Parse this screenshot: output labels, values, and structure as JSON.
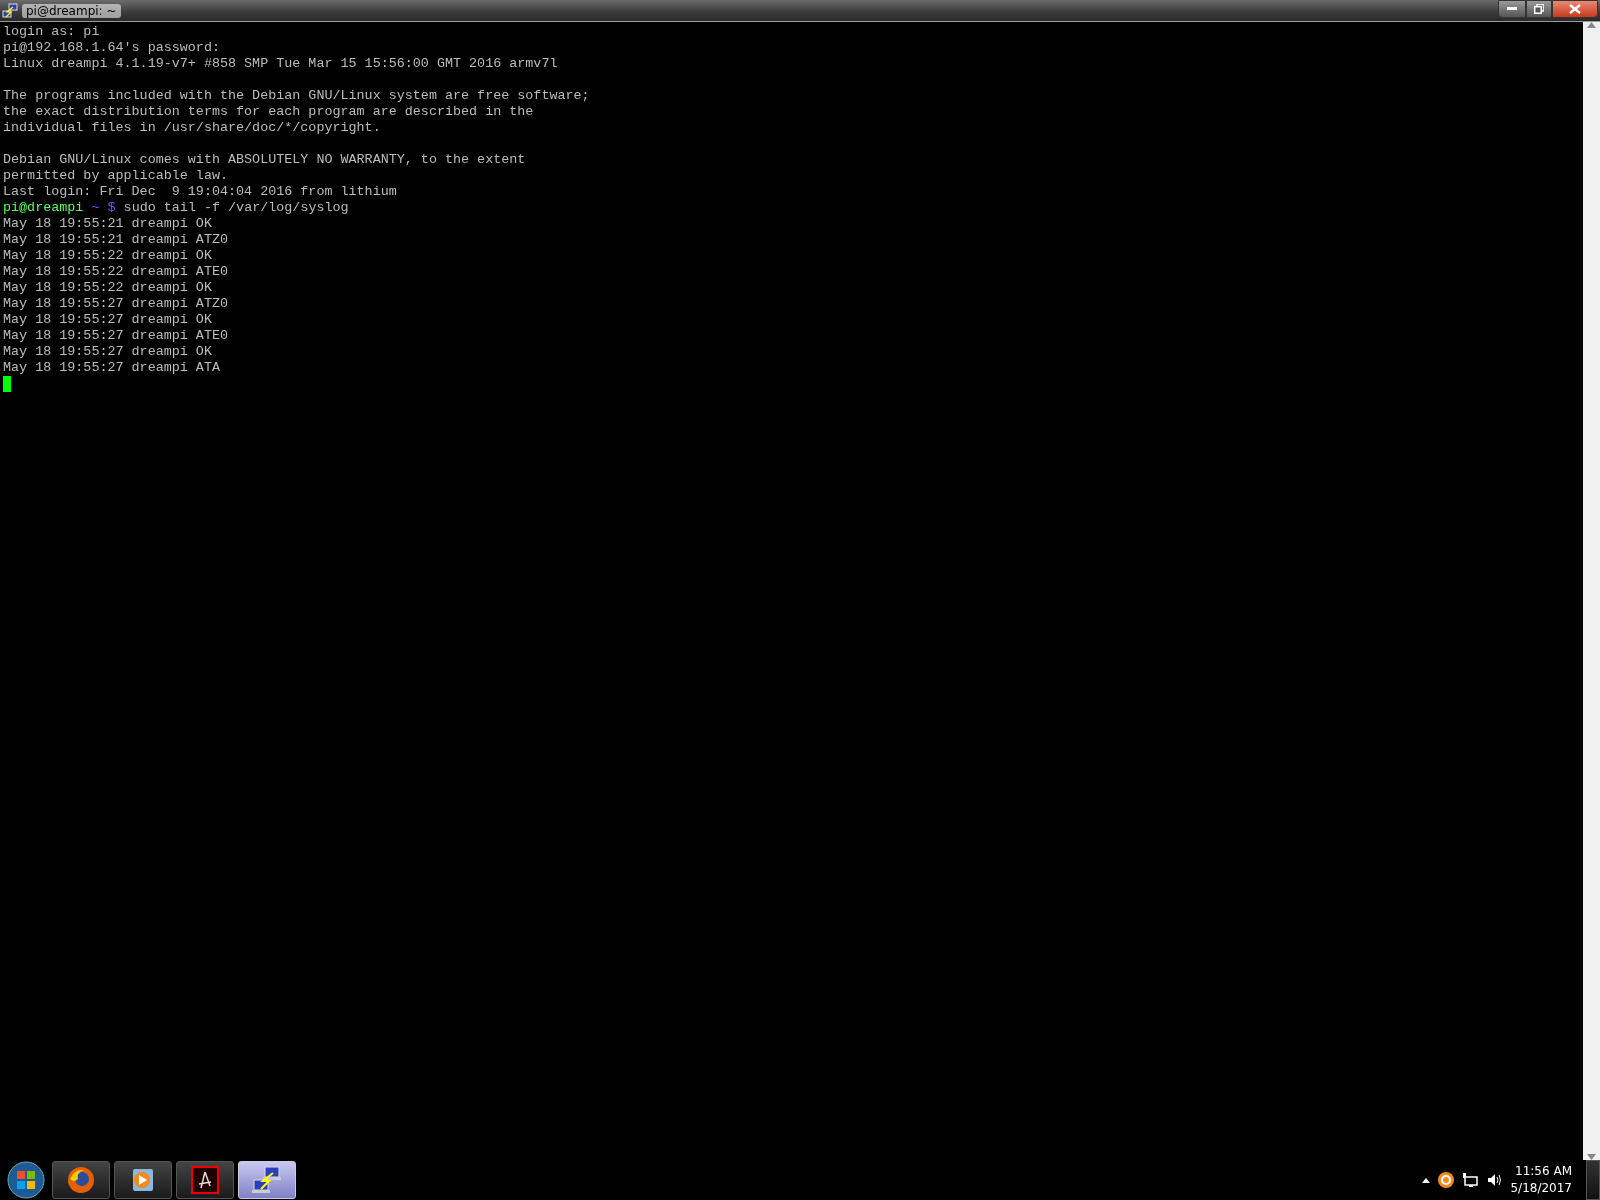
{
  "window": {
    "title": "pi@dreampi: ~"
  },
  "terminal": {
    "lines": [
      {
        "kind": "text",
        "text": "login as: pi"
      },
      {
        "kind": "text",
        "text": "pi@192.168.1.64's password:"
      },
      {
        "kind": "text",
        "text": "Linux dreampi 4.1.19-v7+ #858 SMP Tue Mar 15 15:56:00 GMT 2016 armv7l"
      },
      {
        "kind": "blank"
      },
      {
        "kind": "text",
        "text": "The programs included with the Debian GNU/Linux system are free software;"
      },
      {
        "kind": "text",
        "text": "the exact distribution terms for each program are described in the"
      },
      {
        "kind": "text",
        "text": "individual files in /usr/share/doc/*/copyright."
      },
      {
        "kind": "blank"
      },
      {
        "kind": "text",
        "text": "Debian GNU/Linux comes with ABSOLUTELY NO WARRANTY, to the extent"
      },
      {
        "kind": "text",
        "text": "permitted by applicable law."
      },
      {
        "kind": "text",
        "text": "Last login: Fri Dec  9 19:04:04 2016 from lithium"
      },
      {
        "kind": "prompt",
        "user_host": "pi@dreampi",
        "path": "~",
        "symbol": "$",
        "command": "sudo tail -f /var/log/syslog"
      },
      {
        "kind": "text",
        "text": "May 18 19:55:21 dreampi OK"
      },
      {
        "kind": "text",
        "text": "May 18 19:55:21 dreampi ATZ0"
      },
      {
        "kind": "text",
        "text": "May 18 19:55:22 dreampi OK"
      },
      {
        "kind": "text",
        "text": "May 18 19:55:22 dreampi ATE0"
      },
      {
        "kind": "text",
        "text": "May 18 19:55:22 dreampi OK"
      },
      {
        "kind": "text",
        "text": "May 18 19:55:27 dreampi ATZ0"
      },
      {
        "kind": "text",
        "text": "May 18 19:55:27 dreampi OK"
      },
      {
        "kind": "text",
        "text": "May 18 19:55:27 dreampi ATE0"
      },
      {
        "kind": "text",
        "text": "May 18 19:55:27 dreampi OK"
      },
      {
        "kind": "text",
        "text": "May 18 19:55:27 dreampi ATA"
      },
      {
        "kind": "cursor"
      }
    ]
  },
  "taskbar": {
    "apps": [
      {
        "kind": "browser",
        "selected": false
      },
      {
        "kind": "media",
        "selected": false
      },
      {
        "kind": "pdf",
        "selected": false
      },
      {
        "kind": "terminal",
        "selected": true
      }
    ],
    "clock": {
      "time": "11:56 AM",
      "date": "5/18/2017"
    }
  }
}
